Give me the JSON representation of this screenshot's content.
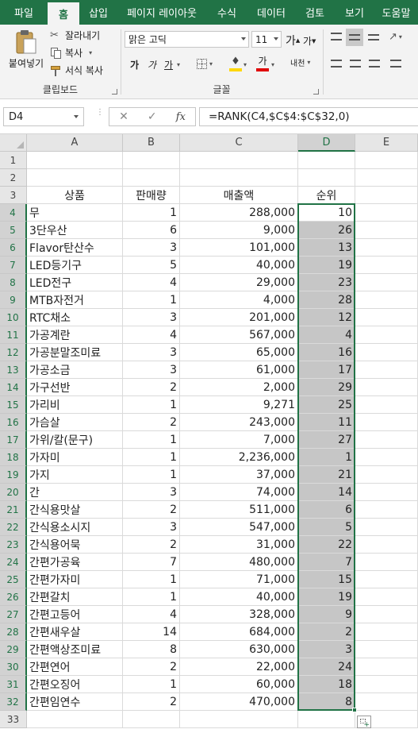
{
  "ribbon": {
    "tabs": [
      "파일",
      "홈",
      "삽입",
      "페이지 레이아웃",
      "수식",
      "데이터",
      "검토",
      "보기",
      "도움말"
    ],
    "active_tab": "홈",
    "clipboard": {
      "paste": "붙여넣기",
      "cut": "잘라내기",
      "copy": "복사",
      "format_painter": "서식 복사",
      "group_label": "클립보드"
    },
    "font": {
      "font_name": "맑은 고딕",
      "font_size": "11",
      "grow_glyph": "가",
      "shrink_glyph": "가",
      "bold": "가",
      "italic": "가",
      "underline": "가",
      "font_color_glyph": "가",
      "phonetic": "내천",
      "group_label": "글꼴"
    },
    "colors": {
      "accent": "#217346",
      "fill": "#ffd700",
      "font_color": "#e00000"
    }
  },
  "formula_bar": {
    "name_box": "D4",
    "cancel": "✕",
    "enter": "✓",
    "fx": "fx",
    "formula": "=RANK(C4,$C$4:$C$32,0)"
  },
  "sheet": {
    "columns": [
      "A",
      "B",
      "C",
      "D",
      "E"
    ],
    "selected_column": "D",
    "row_numbers": [
      "1",
      "2",
      "3",
      "4",
      "5",
      "6",
      "7",
      "8",
      "9",
      "10",
      "11",
      "12",
      "13",
      "14",
      "15",
      "16",
      "17",
      "18",
      "19",
      "20",
      "21",
      "22",
      "23",
      "24",
      "25",
      "26",
      "27",
      "28",
      "29",
      "30",
      "31",
      "32",
      "33"
    ],
    "headers": {
      "product": "상품",
      "qty": "판매량",
      "sales": "매출액",
      "rank": "순위"
    },
    "rows": [
      {
        "product": "무",
        "qty": "1",
        "sales": "288,000",
        "rank": "10"
      },
      {
        "product": "3단우산",
        "qty": "6",
        "sales": "9,000",
        "rank": "26"
      },
      {
        "product": "Flavor탄산수",
        "qty": "3",
        "sales": "101,000",
        "rank": "13"
      },
      {
        "product": "LED등기구",
        "qty": "5",
        "sales": "40,000",
        "rank": "19"
      },
      {
        "product": "LED전구",
        "qty": "4",
        "sales": "29,000",
        "rank": "23"
      },
      {
        "product": "MTB자전거",
        "qty": "1",
        "sales": "4,000",
        "rank": "28"
      },
      {
        "product": "RTC채소",
        "qty": "3",
        "sales": "201,000",
        "rank": "12"
      },
      {
        "product": "가공계란",
        "qty": "4",
        "sales": "567,000",
        "rank": "4"
      },
      {
        "product": "가공분말조미료",
        "qty": "3",
        "sales": "65,000",
        "rank": "16"
      },
      {
        "product": "가공소금",
        "qty": "3",
        "sales": "61,000",
        "rank": "17"
      },
      {
        "product": "가구선반",
        "qty": "2",
        "sales": "2,000",
        "rank": "29"
      },
      {
        "product": "가리비",
        "qty": "1",
        "sales": "9,271",
        "rank": "25"
      },
      {
        "product": "가슴살",
        "qty": "2",
        "sales": "243,000",
        "rank": "11"
      },
      {
        "product": "가위/칼(문구)",
        "qty": "1",
        "sales": "7,000",
        "rank": "27"
      },
      {
        "product": "가자미",
        "qty": "1",
        "sales": "2,236,000",
        "rank": "1"
      },
      {
        "product": "가지",
        "qty": "1",
        "sales": "37,000",
        "rank": "21"
      },
      {
        "product": "간",
        "qty": "3",
        "sales": "74,000",
        "rank": "14"
      },
      {
        "product": "간식용맛살",
        "qty": "2",
        "sales": "511,000",
        "rank": "6"
      },
      {
        "product": "간식용소시지",
        "qty": "3",
        "sales": "547,000",
        "rank": "5"
      },
      {
        "product": "간식용어묵",
        "qty": "2",
        "sales": "31,000",
        "rank": "22"
      },
      {
        "product": "간편가공육",
        "qty": "7",
        "sales": "480,000",
        "rank": "7"
      },
      {
        "product": "간편가자미",
        "qty": "1",
        "sales": "71,000",
        "rank": "15"
      },
      {
        "product": "간편갈치",
        "qty": "1",
        "sales": "40,000",
        "rank": "19"
      },
      {
        "product": "간편고등어",
        "qty": "4",
        "sales": "328,000",
        "rank": "9"
      },
      {
        "product": "간편새우살",
        "qty": "14",
        "sales": "684,000",
        "rank": "2"
      },
      {
        "product": "간편액상조미료",
        "qty": "8",
        "sales": "630,000",
        "rank": "3"
      },
      {
        "product": "간편연어",
        "qty": "2",
        "sales": "22,000",
        "rank": "24"
      },
      {
        "product": "간편오징어",
        "qty": "1",
        "sales": "60,000",
        "rank": "18"
      },
      {
        "product": "간편임연수",
        "qty": "2",
        "sales": "470,000",
        "rank": "8"
      }
    ]
  }
}
